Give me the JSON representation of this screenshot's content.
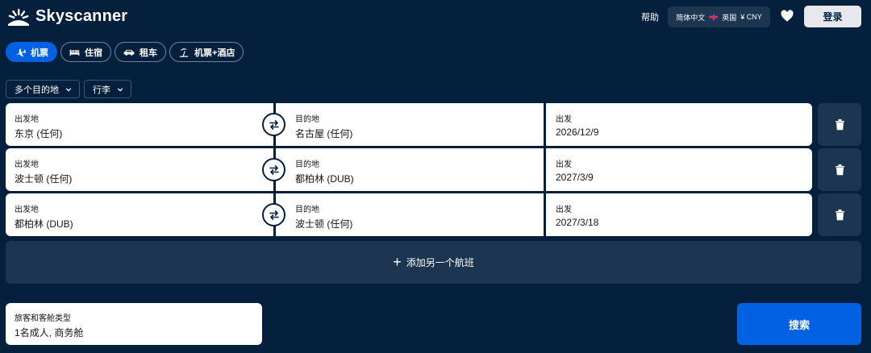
{
  "brand": {
    "name": "Skyscanner"
  },
  "header": {
    "help": "帮助",
    "locale": {
      "language": "简体中文",
      "country": "英国",
      "currency": "¥ CNY"
    },
    "login": "登录"
  },
  "tabs": [
    {
      "label": "机票",
      "icon": "plane-icon",
      "active": true
    },
    {
      "label": "住宿",
      "icon": "bed-icon",
      "active": false
    },
    {
      "label": "租车",
      "icon": "car-icon",
      "active": false
    },
    {
      "label": "机票+酒店",
      "icon": "beach-icon",
      "active": false
    }
  ],
  "filters": {
    "trip_type": "多个目的地",
    "baggage": "行李"
  },
  "legs": [
    {
      "origin_label": "出发地",
      "origin": "东京 (任何)",
      "dest_label": "目的地",
      "dest": "名古屋 (任何)",
      "date_label": "出发",
      "date": "2026/12/9"
    },
    {
      "origin_label": "出发地",
      "origin": "波士顿 (任何)",
      "dest_label": "目的地",
      "dest": "都柏林 (DUB)",
      "date_label": "出发",
      "date": "2027/3/9"
    },
    {
      "origin_label": "出发地",
      "origin": "都柏林 (DUB)",
      "dest_label": "目的地",
      "dest": "波士顿 (任何)",
      "date_label": "出发",
      "date": "2027/3/18"
    }
  ],
  "add_flight": "添加另一个航班",
  "travellers": {
    "label": "旅客和客舱类型",
    "value": "1名成人, 商务舱"
  },
  "search": "搜索",
  "colors": {
    "background": "#05203c",
    "accent": "#0062e3",
    "panel": "#1c3550"
  }
}
